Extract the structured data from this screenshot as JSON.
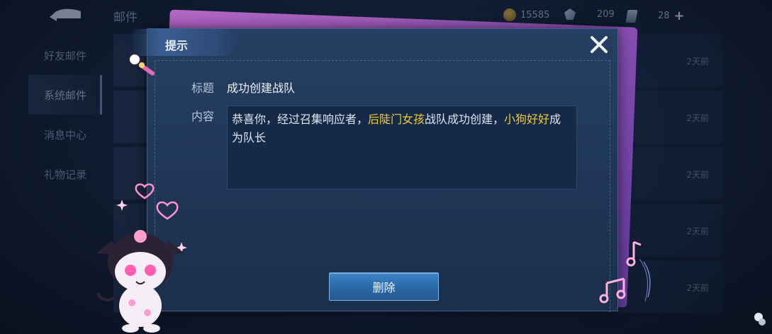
{
  "background": {
    "title": "邮件",
    "currency": [
      {
        "icon": "coin-icon",
        "value": "15585"
      },
      {
        "icon": "gem-icon",
        "value": "209"
      },
      {
        "icon": "coupon-icon",
        "value": "28"
      }
    ],
    "sidebar": [
      {
        "label": "好友邮件",
        "active": false
      },
      {
        "label": "系统邮件",
        "active": true
      },
      {
        "label": "消息中心",
        "active": false
      },
      {
        "label": "礼物记录",
        "active": false
      }
    ],
    "mail_days": [
      "2天前",
      "2天前",
      "2天前",
      "2天前",
      "2天前"
    ]
  },
  "dialog": {
    "title": "提示",
    "subject_label": "标题",
    "subject_value": "成功创建战队",
    "content_label": "内容",
    "content_parts": {
      "p1": "恭喜你，经过召集响应者，",
      "team": "后陡门女孩",
      "p2": "战队成功创建，",
      "captain": "小狗好好",
      "p3": "成为队长"
    },
    "delete_label": "删除"
  },
  "colors": {
    "highlight": "#f1c93b",
    "dialog_bg": "#1f3656",
    "button": "#2b6aa8",
    "pink_card": "#a45ac8"
  }
}
